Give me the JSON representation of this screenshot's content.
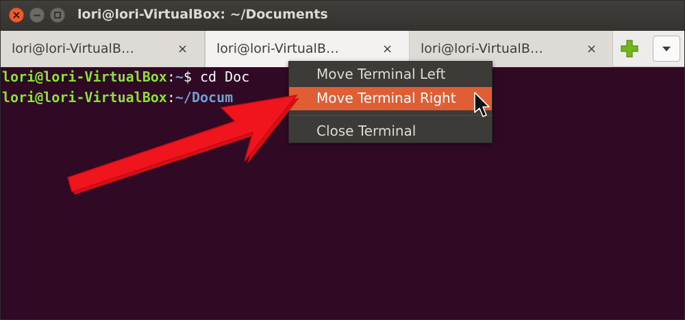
{
  "window": {
    "title": "lori@lori-VirtualBox: ~/Documents"
  },
  "tabs": [
    {
      "label": "lori@lori-VirtualB…",
      "close": "×",
      "active": false
    },
    {
      "label": "lori@lori-VirtualB…",
      "close": "×",
      "active": true
    },
    {
      "label": "lori@lori-VirtualB…",
      "close": "×",
      "active": false
    }
  ],
  "toolbar": {
    "new_tab_icon": "plus-icon",
    "menu_icon": "chevron-down-icon"
  },
  "terminal": {
    "lines": [
      {
        "user": "lori@lori-VirtualBox",
        "sep": ":",
        "path": "~",
        "prompt": "$ ",
        "cmd": "cd Doc"
      },
      {
        "user": "lori@lori-VirtualBox",
        "sep": ":",
        "path": "~/Docum",
        "prompt": "",
        "cmd": ""
      }
    ]
  },
  "context_menu": {
    "items": [
      {
        "label": "Move Terminal Left",
        "highlighted": false
      },
      {
        "label": "Move Terminal Right",
        "highlighted": true
      },
      {
        "label": "Close Terminal",
        "highlighted": false
      }
    ]
  },
  "colors": {
    "terminal_bg": "#300a24",
    "prompt_user": "#8ae234",
    "prompt_path": "#729fcf",
    "menu_highlight": "#e05e34",
    "arrow": "#e8141c",
    "close_button": "#ee5c2c"
  }
}
